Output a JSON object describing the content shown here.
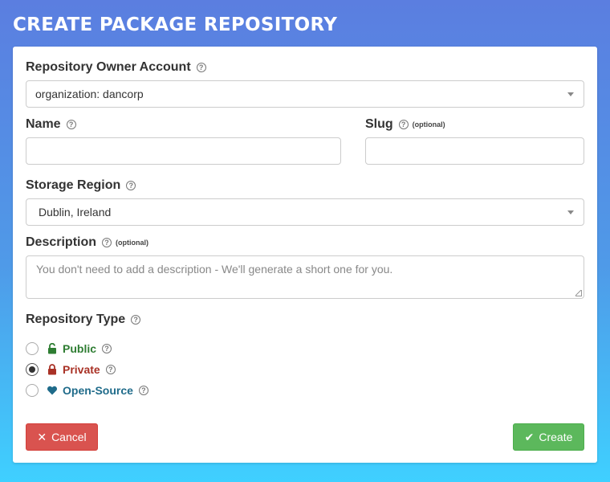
{
  "page": {
    "title": "CREATE PACKAGE REPOSITORY"
  },
  "form": {
    "owner": {
      "label": "Repository Owner Account",
      "help": "?",
      "value": "organization: dancorp"
    },
    "name": {
      "label": "Name",
      "help": "?",
      "value": ""
    },
    "slug": {
      "label": "Slug",
      "help": "?",
      "optional": "(optional)",
      "value": ""
    },
    "region": {
      "label": "Storage Region",
      "help": "?",
      "value": "Dublin, Ireland"
    },
    "description": {
      "label": "Description",
      "help": "?",
      "optional": "(optional)",
      "placeholder": "You don't need to add a description - We'll generate a short one for you."
    },
    "type": {
      "label": "Repository Type",
      "help": "?",
      "options": [
        {
          "label": "Public",
          "icon": "unlock-icon",
          "color": "#2e7d32",
          "checked": false
        },
        {
          "label": "Private",
          "icon": "lock-icon",
          "color": "#a93226",
          "checked": true
        },
        {
          "label": "Open-Source",
          "icon": "heart-icon",
          "color": "#1f6b8a",
          "checked": false
        }
      ]
    }
  },
  "actions": {
    "cancel_label": "Cancel",
    "create_label": "Create",
    "cancel_color": "#d9534f",
    "create_color": "#5cb85c"
  }
}
